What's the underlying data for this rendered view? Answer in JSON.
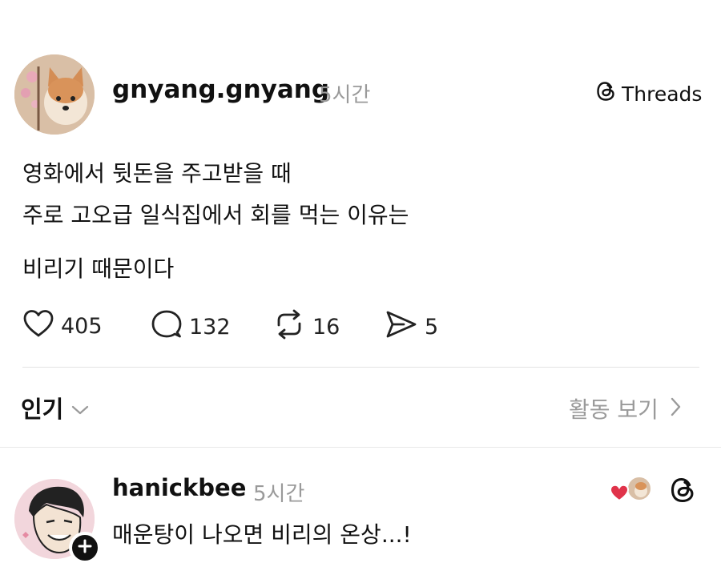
{
  "post": {
    "username": "gnyang.gnyang",
    "time": "5시간",
    "badge": "Threads",
    "lines": [
      "영화에서 뒷돈을 주고받을 때",
      "주로 고오급 일식집에서 회를 먹는 이유는",
      "비리기 때문이다"
    ],
    "stats": {
      "likes": "405",
      "comments": "132",
      "reposts": "16",
      "shares": "5"
    }
  },
  "sort": {
    "label": "인기",
    "activity": "활동 보기"
  },
  "reply": {
    "username": "hanickbee",
    "time": "5시간",
    "text": "매운탕이 나오면 비리의 온상...!"
  },
  "colors": {
    "text": "#111111",
    "muted": "#9a9a9a",
    "heart": "#e0334a"
  },
  "icons": [
    "heart-icon",
    "comment-icon",
    "repost-icon",
    "share-icon",
    "threads-logo-icon",
    "chevron-down-icon",
    "chevron-right-icon",
    "plus-icon"
  ]
}
